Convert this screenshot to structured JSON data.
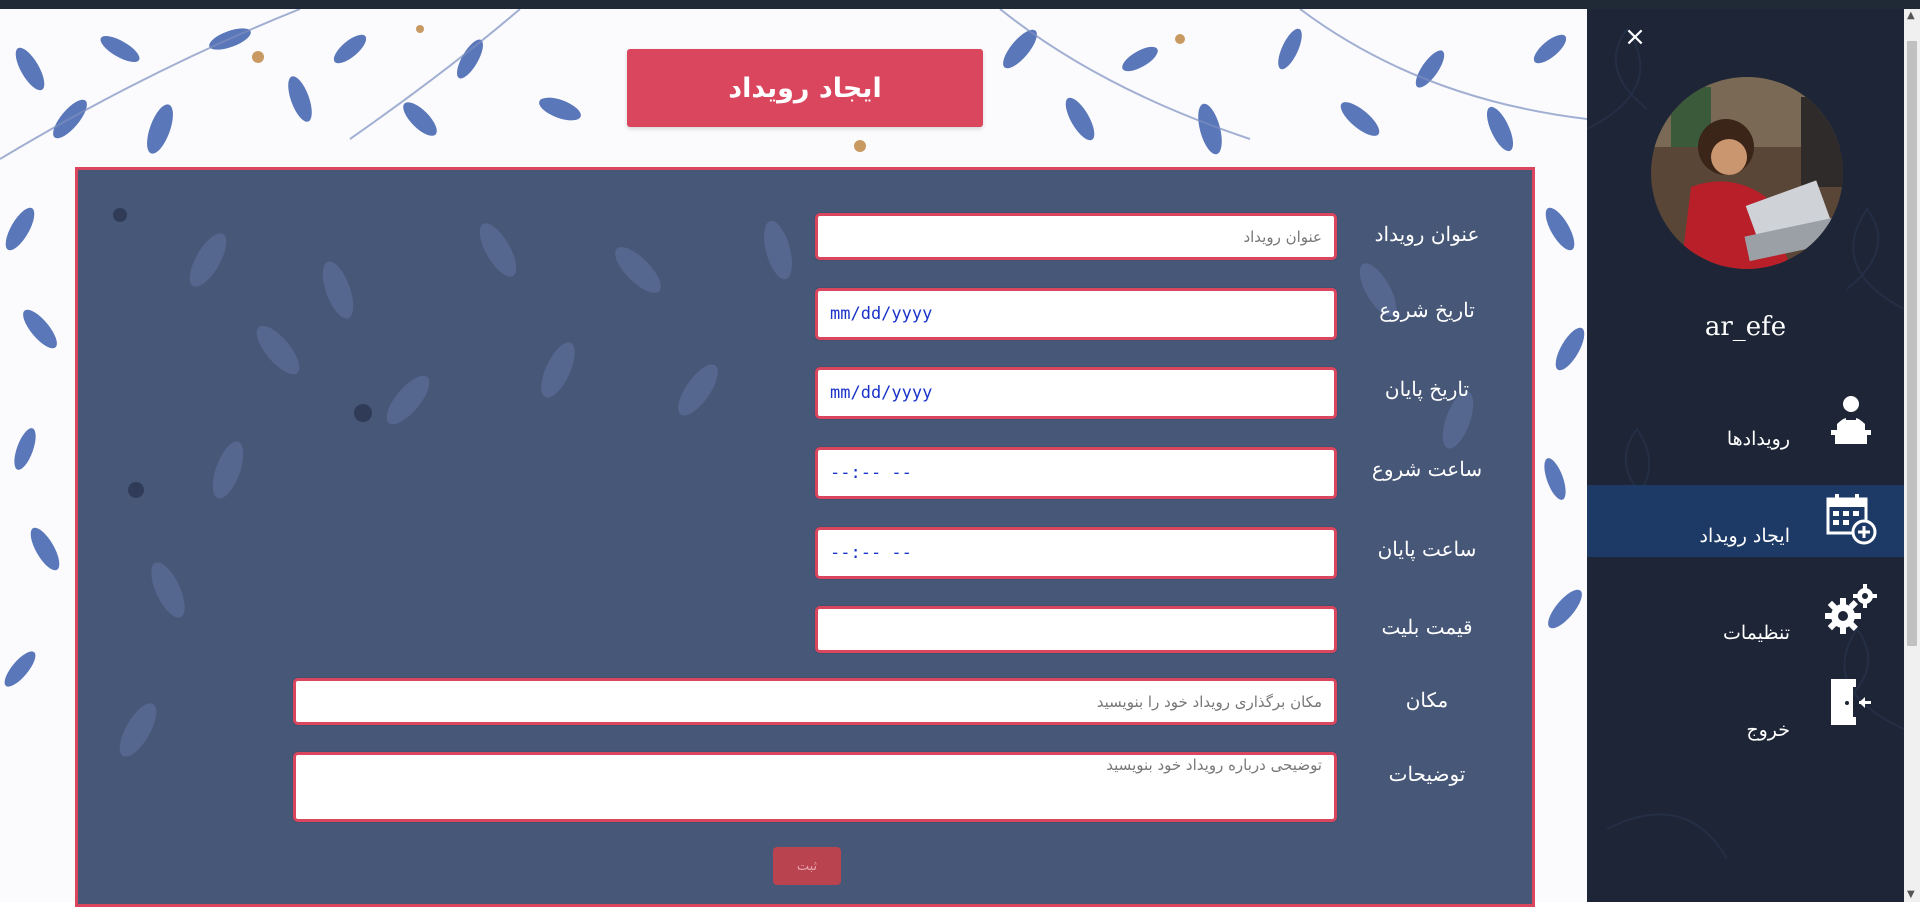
{
  "page": {
    "title": "ایجاد رویداد"
  },
  "form": {
    "fields": [
      {
        "label": "عنوان رویداد",
        "placeholder": "عنوان رویداد"
      },
      {
        "label": "تاریخ شروع",
        "placeholder": "mm/dd/yyyy"
      },
      {
        "label": "تاریخ پایان",
        "placeholder": "mm/dd/yyyy"
      },
      {
        "label": "ساعت شروع",
        "placeholder": "--:-- --"
      },
      {
        "label": "ساعت پایان",
        "placeholder": "--:-- --"
      },
      {
        "label": "قیمت بلیت",
        "placeholder": ""
      },
      {
        "label": "مکان",
        "placeholder": "مکان برگذاری رویداد خود را بنویسید"
      },
      {
        "label": "توضیحات",
        "placeholder": "توضیحی درباره رویداد خود بنویسید"
      }
    ],
    "submit_label": "ثبت"
  },
  "sidebar": {
    "close_icon": "close-icon",
    "username": "ar_efe",
    "items": [
      {
        "label": "رویدادها",
        "icon": "presenter-icon",
        "active": false
      },
      {
        "label": "ایجاد رویداد",
        "icon": "calendar-add-icon",
        "active": true
      },
      {
        "label": "تنظیمات",
        "icon": "gears-icon",
        "active": false
      },
      {
        "label": "خروج",
        "icon": "exit-door-icon",
        "active": false
      }
    ]
  },
  "colors": {
    "accent": "#d9465e",
    "panel": "#3b4c70",
    "sidebar": "#1d2536",
    "sidebar_active": "#1d3a66",
    "date_text": "#1a33c8"
  }
}
